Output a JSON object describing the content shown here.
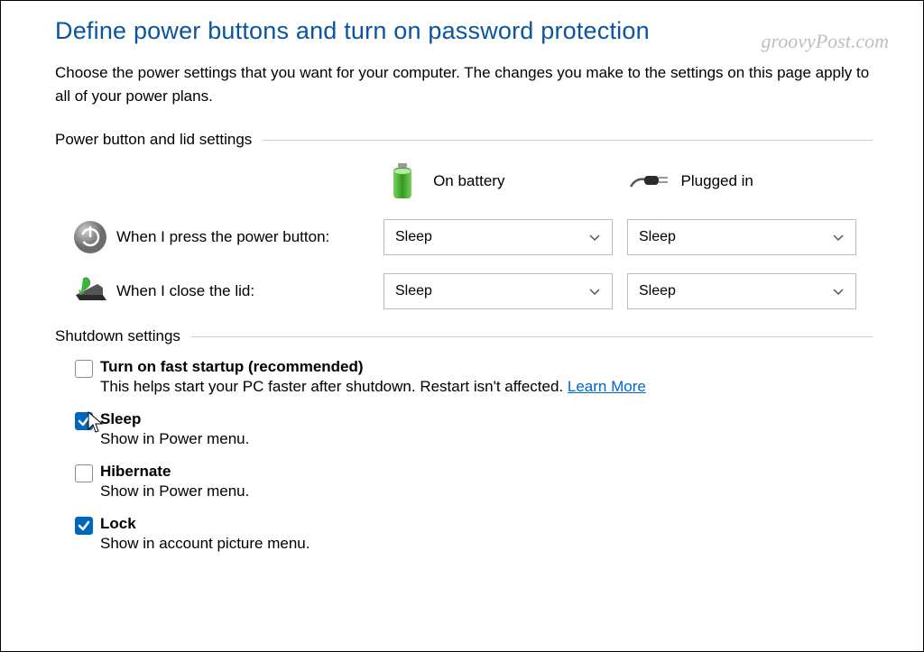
{
  "watermark": "groovyPost.com",
  "title": "Define power buttons and turn on password protection",
  "description": "Choose the power settings that you want for your computer. The changes you make to the settings on this page apply to all of your power plans.",
  "section_power_lid": "Power button and lid settings",
  "section_shutdown": "Shutdown settings",
  "columns": {
    "battery": "On battery",
    "plugged": "Plugged in"
  },
  "rows": {
    "power_button": {
      "label": "When I press the power button:",
      "battery_value": "Sleep",
      "plugged_value": "Sleep"
    },
    "close_lid": {
      "label": "When I close the lid:",
      "battery_value": "Sleep",
      "plugged_value": "Sleep"
    }
  },
  "shutdown": [
    {
      "key": "fast_startup",
      "title": "Turn on fast startup (recommended)",
      "desc": "This helps start your PC faster after shutdown. Restart isn't affected. ",
      "link": "Learn More",
      "checked": false
    },
    {
      "key": "sleep",
      "title": "Sleep",
      "desc": "Show in Power menu.",
      "checked": true
    },
    {
      "key": "hibernate",
      "title": "Hibernate",
      "desc": "Show in Power menu.",
      "checked": false
    },
    {
      "key": "lock",
      "title": "Lock",
      "desc": "Show in account picture menu.",
      "checked": true
    }
  ]
}
